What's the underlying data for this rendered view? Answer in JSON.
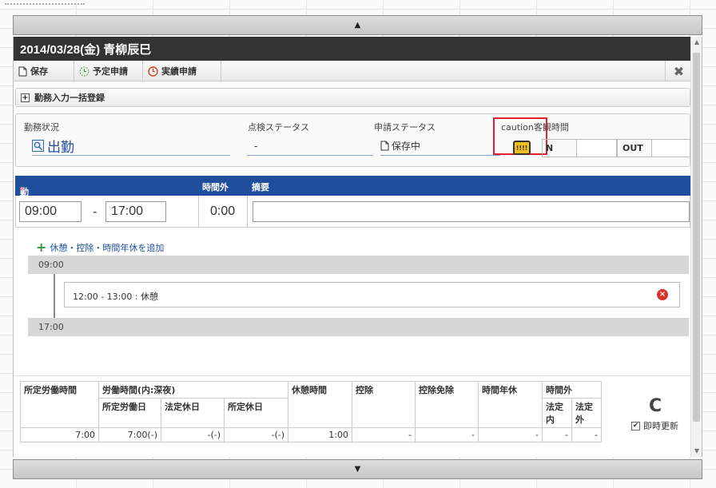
{
  "scroll": {
    "up_glyph": "▲",
    "down_glyph": "▼"
  },
  "dialog": {
    "title": "2014/03/28(金)   青柳辰巳",
    "toolbar": {
      "save_label": "保存",
      "plan_request_label": "予定申請",
      "actual_request_label": "実績申請",
      "close_glyph": "✖"
    },
    "batch_entry_label": "勤務入力一括登録",
    "status": {
      "work_status_label": "勤務状況",
      "work_status_value": "出勤",
      "check_status_label": "点検ステータス",
      "check_status_value": "-",
      "request_status_label": "申請ステータス",
      "request_status_value": "保存中",
      "caution_text": "caution",
      "caution_icon_text": "!!!!",
      "visit_time_label": "客観時間",
      "in_label": "N",
      "out_label": "OUT"
    },
    "work": {
      "header_work_time": "勤務時間",
      "required_mark": "*",
      "header_overtime": "時間外",
      "header_summary": "摘要",
      "start_time": "09:00",
      "separator": "-",
      "end_time": "17:00",
      "overtime_value": "0:00",
      "summary_value": ""
    },
    "breaks": {
      "add_label": "休憩・控除・時間年休を追加",
      "start_marker": "09:00",
      "end_marker": "17:00",
      "items": [
        {
          "text": "12:00 - 13:00 : 休憩"
        }
      ]
    },
    "summary": {
      "headers": {
        "scheduled": "所定労働時間",
        "worked": "労働時間(内:深夜)",
        "worked_sched_day": "所定労働日",
        "worked_legal_holiday": "法定休日",
        "worked_sched_holiday": "所定休日",
        "break": "休憩時間",
        "deduction": "控除",
        "deduction_exempt": "控除免除",
        "hourly_leave": "時間年休",
        "overtime": "時間外",
        "overtime_legal_in": "法定内",
        "overtime_legal_out": "法定外"
      },
      "values": {
        "scheduled": "7:00",
        "worked_sched_day": "7:00(-)",
        "worked_legal_holiday": "-(-)",
        "worked_sched_holiday": "-(-)",
        "break": "1:00",
        "deduction": "-",
        "deduction_exempt": "-",
        "hourly_leave": "-",
        "overtime_legal_in": "-",
        "overtime_legal_out": "-"
      },
      "refresh_glyph": "C",
      "auto_update_label": "即時更新",
      "auto_update_checked": true
    }
  }
}
